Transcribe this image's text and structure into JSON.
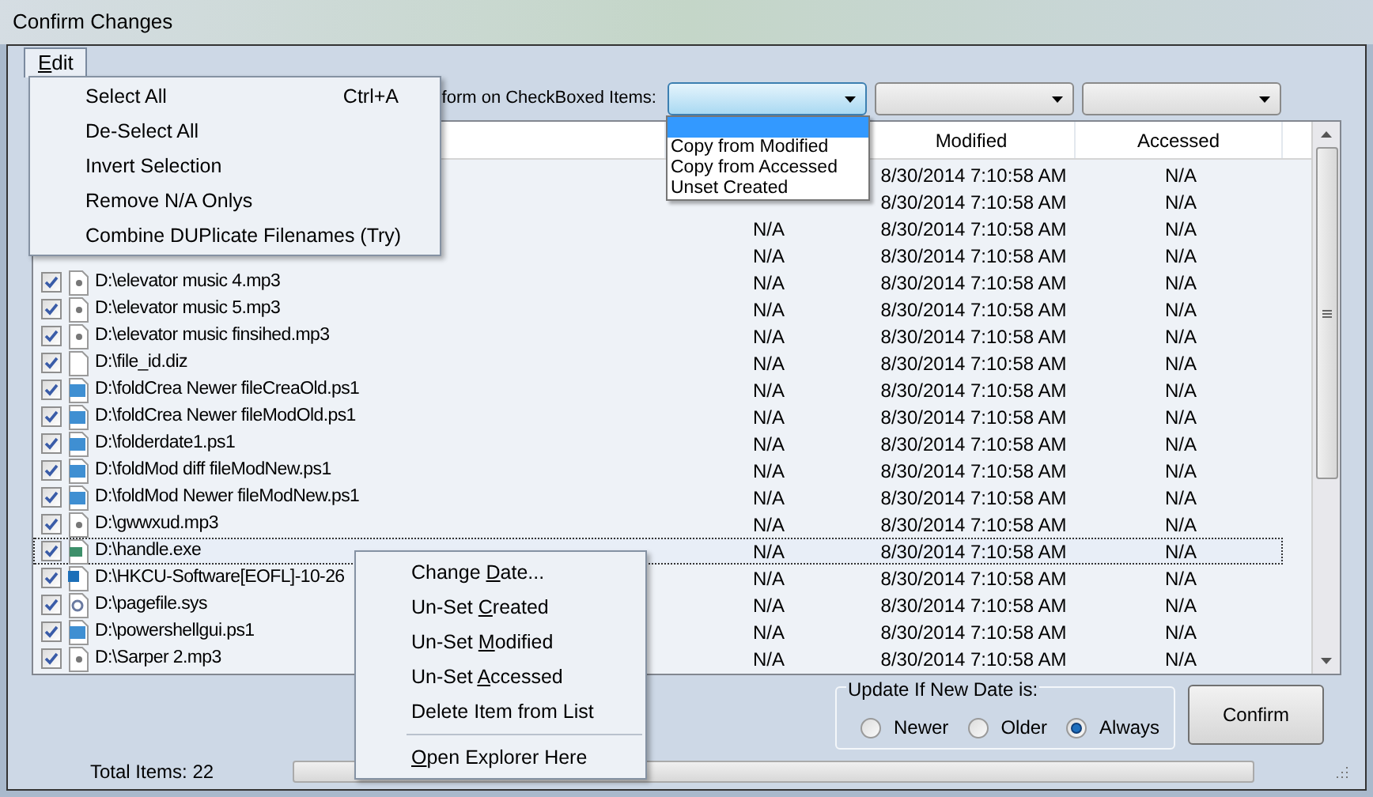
{
  "window": {
    "title": "Confirm Changes"
  },
  "menu_bar": {
    "items": [
      {
        "key": "E",
        "post": "dit",
        "open": true
      }
    ]
  },
  "edit_menu": {
    "items": [
      {
        "label": "Select All",
        "shortcut": "Ctrl+A"
      },
      {
        "label": "De-Select All"
      },
      {
        "label": "Invert Selection"
      },
      {
        "label": "Remove N/A Onlys"
      },
      {
        "label": "Combine DUPlicate Filenames (Try)"
      }
    ]
  },
  "toolbar": {
    "label": "form on CheckBoxed Items:",
    "dropdowns": [
      {
        "open": true
      },
      {
        "open": false
      },
      {
        "open": false
      }
    ]
  },
  "dropdown_list": {
    "items": [
      {
        "selected": true
      },
      {
        "label": "Copy from Modified",
        "selected": false
      },
      {
        "label": "Copy from Accessed",
        "selected": false
      },
      {
        "label": "Unset Created",
        "selected": false
      }
    ]
  },
  "table": {
    "columns": [
      "Modified",
      "Accessed"
    ],
    "rows": [
      {
        "modified": "8/30/2014 7:10:58 AM",
        "accessed": "N/A",
        "focused": false
      },
      {
        "modified": "8/30/2014 7:10:58 AM",
        "accessed": "N/A",
        "focused": false
      },
      {
        "created": "N/A",
        "modified": "8/30/2014 7:10:58 AM",
        "accessed": "N/A",
        "focused": false
      },
      {
        "created": "N/A",
        "modified": "8/30/2014 7:10:58 AM",
        "accessed": "N/A",
        "focused": false
      },
      {
        "checked": true,
        "kind": "audio",
        "name": "D:\\elevator music 4.mp3",
        "created": "N/A",
        "modified": "8/30/2014 7:10:58 AM",
        "accessed": "N/A",
        "focused": false
      },
      {
        "checked": true,
        "kind": "audio",
        "name": "D:\\elevator music 5.mp3",
        "created": "N/A",
        "modified": "8/30/2014 7:10:58 AM",
        "accessed": "N/A",
        "focused": false
      },
      {
        "checked": true,
        "kind": "audio",
        "name": "D:\\elevator music finsihed.mp3",
        "created": "N/A",
        "modified": "8/30/2014 7:10:58 AM",
        "accessed": "N/A",
        "focused": false
      },
      {
        "checked": true,
        "kind": "blank",
        "name": "D:\\file_id.diz",
        "created": "N/A",
        "modified": "8/30/2014 7:10:58 AM",
        "accessed": "N/A",
        "focused": false
      },
      {
        "checked": true,
        "kind": "script",
        "name": "D:\\foldCrea Newer fileCreaOld.ps1",
        "created": "N/A",
        "modified": "8/30/2014 7:10:58 AM",
        "accessed": "N/A",
        "focused": false
      },
      {
        "checked": true,
        "kind": "script",
        "name": "D:\\foldCrea Newer fileModOld.ps1",
        "created": "N/A",
        "modified": "8/30/2014 7:10:58 AM",
        "accessed": "N/A",
        "focused": false
      },
      {
        "checked": true,
        "kind": "script",
        "name": "D:\\folderdate1.ps1",
        "created": "N/A",
        "modified": "8/30/2014 7:10:58 AM",
        "accessed": "N/A",
        "focused": false
      },
      {
        "checked": true,
        "kind": "script",
        "name": "D:\\foldMod diff fileModNew.ps1",
        "created": "N/A",
        "modified": "8/30/2014 7:10:58 AM",
        "accessed": "N/A",
        "focused": false
      },
      {
        "checked": true,
        "kind": "script",
        "name": "D:\\foldMod Newer fileModNew.ps1",
        "created": "N/A",
        "modified": "8/30/2014 7:10:58 AM",
        "accessed": "N/A",
        "focused": false
      },
      {
        "checked": true,
        "kind": "audio",
        "name": "D:\\gwwxud.mp3",
        "created": "N/A",
        "modified": "8/30/2014 7:10:58 AM",
        "accessed": "N/A",
        "focused": false
      },
      {
        "checked": true,
        "kind": "program",
        "name": "D:\\handle.exe",
        "created": "N/A",
        "modified": "8/30/2014 7:10:58 AM",
        "accessed": "N/A",
        "focused": true
      },
      {
        "checked": true,
        "kind": "registry",
        "name": "D:\\HKCU-Software[EOFL]-10-26",
        "created": "N/A",
        "modified": "8/30/2014 7:10:58 AM",
        "accessed": "N/A",
        "focused": false
      },
      {
        "checked": true,
        "kind": "system",
        "name": "D:\\pagefile.sys",
        "created": "N/A",
        "modified": "8/30/2014 7:10:58 AM",
        "accessed": "N/A",
        "focused": false
      },
      {
        "checked": true,
        "kind": "script",
        "name": "D:\\powershellgui.ps1",
        "created": "N/A",
        "modified": "8/30/2014 7:10:58 AM",
        "accessed": "N/A",
        "focused": false
      },
      {
        "checked": true,
        "kind": "audio",
        "name": "D:\\Sarper 2.mp3",
        "created": "N/A",
        "modified": "8/30/2014 7:10:58 AM",
        "accessed": "N/A",
        "focused": false
      }
    ]
  },
  "context_menu": {
    "items": [
      {
        "kind": "item",
        "pre": "Change ",
        "key": "D",
        "post": "ate..."
      },
      {
        "kind": "item",
        "pre": "Un-Set ",
        "key": "C",
        "post": "reated"
      },
      {
        "kind": "item",
        "pre": "Un-Set ",
        "key": "M",
        "post": "odified"
      },
      {
        "kind": "item",
        "pre": "Un-Set ",
        "key": "A",
        "post": "ccessed"
      },
      {
        "kind": "item",
        "pre": "Delete Item from List"
      },
      {
        "kind": "separator"
      },
      {
        "kind": "item",
        "key": "O",
        "post": "pen Explorer Here"
      }
    ]
  },
  "update_group": {
    "title": "Update If New Date is:",
    "options": [
      {
        "label": "Newer",
        "selected": false
      },
      {
        "label": "Older",
        "selected": false
      },
      {
        "label": "Always",
        "selected": true
      }
    ]
  },
  "confirm_button": "Confirm",
  "status_bar": {
    "total": "Total Items: 22",
    "progress": {
      "level": 0
    }
  }
}
